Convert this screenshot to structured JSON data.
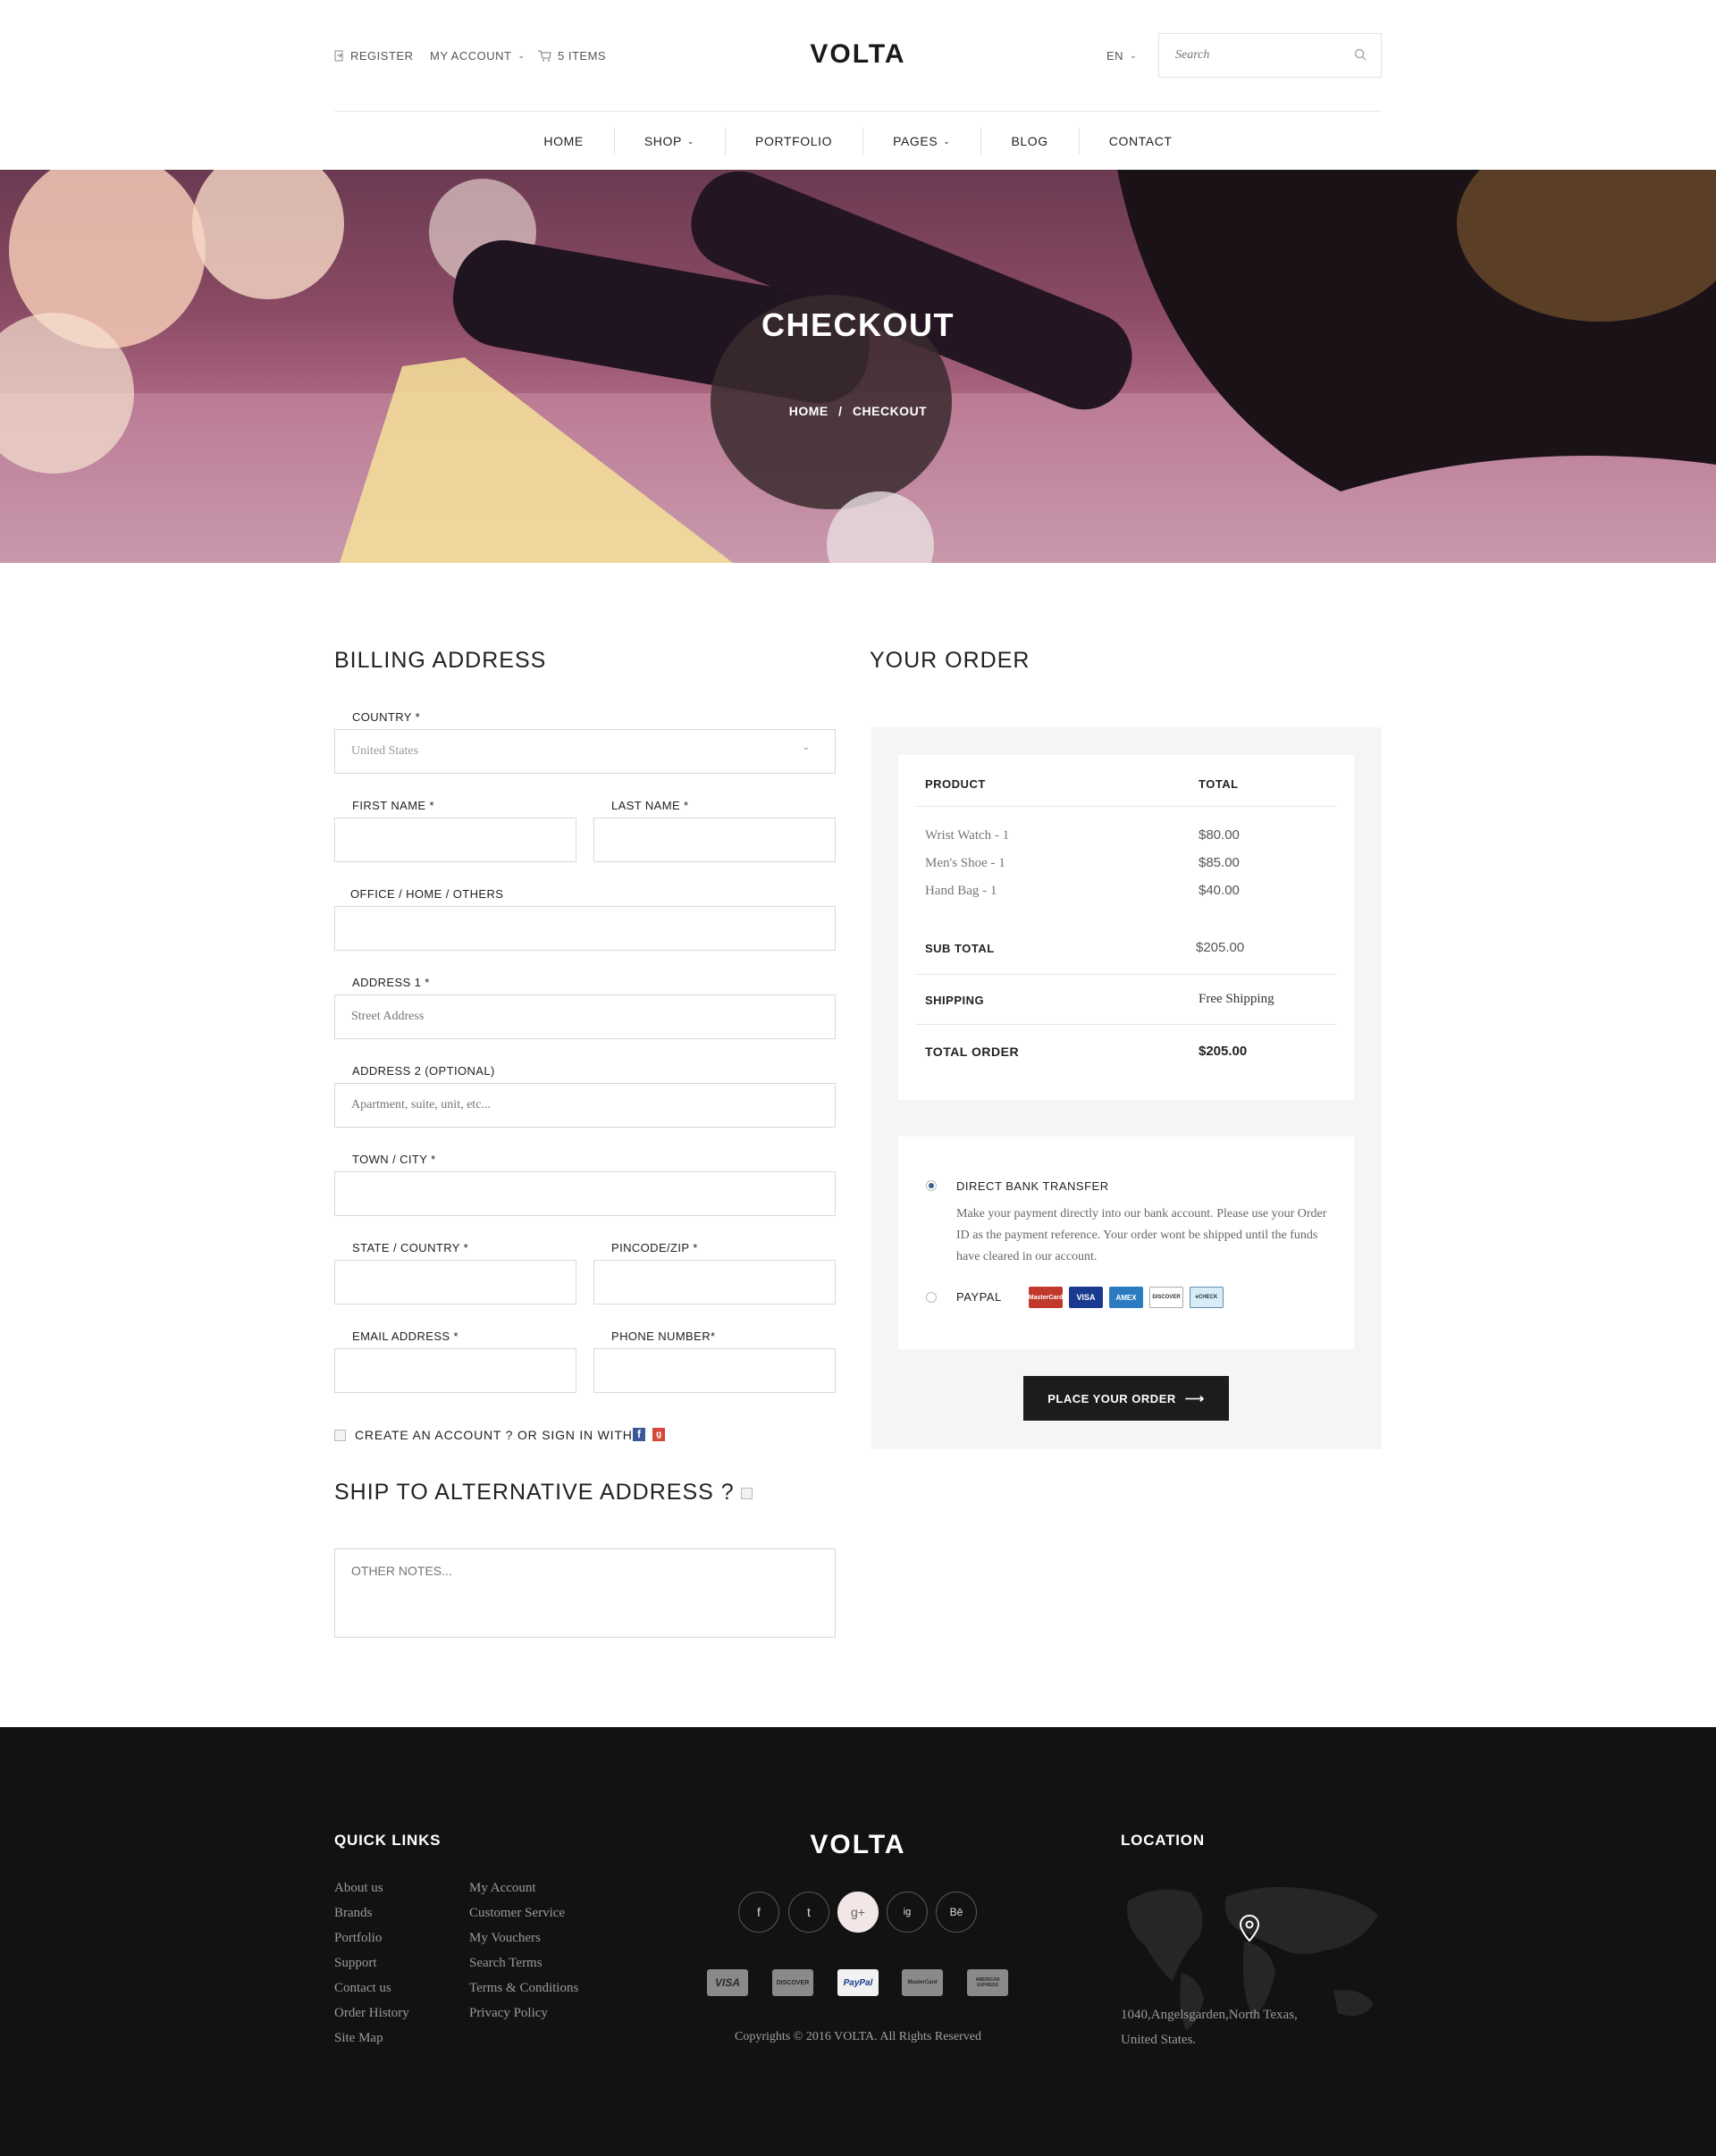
{
  "header": {
    "register": "REGISTER",
    "my_account": "MY ACCOUNT",
    "cart": "5 ITEMS",
    "logo": "VOLTA",
    "lang": "EN",
    "search_placeholder": "Search"
  },
  "nav": [
    "HOME",
    "SHOP",
    "PORTFOLIO",
    "PAGES",
    "BLOG",
    "CONTACT"
  ],
  "hero": {
    "title": "CHECKOUT",
    "crumb_home": "HOME",
    "crumb_sep": "/",
    "crumb_current": "CHECKOUT"
  },
  "billing": {
    "title": "BILLING ADDRESS",
    "country_label": "COUNTRY *",
    "country_value": "United States",
    "first_name_label": "FIRST NAME *",
    "last_name_label": "LAST NAME *",
    "office_label": "OFFICE / HOME /  OTHERS",
    "address1_label": "ADDRESS 1 *",
    "address1_placeholder": "Street Address",
    "address2_label": "ADDRESS 2 (OPTIONAL)",
    "address2_placeholder": "Apartment, suite, unit, etc...",
    "town_label": "TOWN / CITY *",
    "state_label": "STATE / COUNTRY *",
    "zip_label": "PINCODE/ZIP *",
    "email_label": "EMAIL ADDRESS *",
    "phone_label": "PHONE NUMBER*",
    "create_account": "CREATE AN ACCOUNT ? OR SIGN IN WITH",
    "ship_alt": "SHIP TO ALTERNATIVE ADDRESS ?",
    "notes_placeholder": "OTHER NOTES..."
  },
  "order": {
    "title": "YOUR ORDER",
    "col_product": "PRODUCT",
    "col_total": "TOTAL",
    "items": [
      {
        "name": "Wrist Watch - 1",
        "price": "$80.00"
      },
      {
        "name": "Men's Shoe - 1",
        "price": "$85.00"
      },
      {
        "name": "Hand Bag - 1",
        "price": "$40.00"
      }
    ],
    "subtotal_label": "SUB TOTAL",
    "subtotal_value": "$205.00",
    "shipping_label": "SHIPPING",
    "shipping_value": "Free Shipping",
    "total_label": "TOTAL ORDER",
    "total_value": "$205.00",
    "payment": {
      "bank_label": "DIRECT BANK TRANSFER",
      "bank_note": "Make your payment directly into our bank account. Please use your Order ID as the payment reference. Your order wont be shipped until the funds have cleared in our account.",
      "paypal_label": "PAYPAL",
      "cards": [
        "MasterCard",
        "VISA",
        "AMEX",
        "DISCOVER",
        "eCHECK"
      ]
    },
    "place_button": "PLACE YOUR ORDER"
  },
  "footer": {
    "quick_links_title": "QUICK LINKS",
    "links_col1": [
      "About us",
      "Brands",
      "Portfolio",
      "Support",
      "Contact us",
      "Order History",
      "Site Map"
    ],
    "links_col2": [
      "My Account",
      "Customer Service",
      "My Vouchers",
      "Search Terms",
      "Terms & Conditions",
      "Privacy Policy"
    ],
    "logo": "VOLTA",
    "social": [
      "f",
      "t",
      "g+",
      "ig",
      "Bē"
    ],
    "payment_logos": [
      "VISA",
      "DISCOVER",
      "PayPal",
      "MasterCard",
      "AMERICAN EXPRESS"
    ],
    "copyright": "Copyrights © 2016 VOLTA. All Rights Reserved",
    "location_title": "LOCATION",
    "address_line1": "1040,Angelsgarden,North Texas,",
    "address_line2": "United States."
  },
  "colors": {
    "accent_dark": "#1c1c1c",
    "footer_bg": "#121212",
    "panel_bg": "#f5f5f5"
  }
}
